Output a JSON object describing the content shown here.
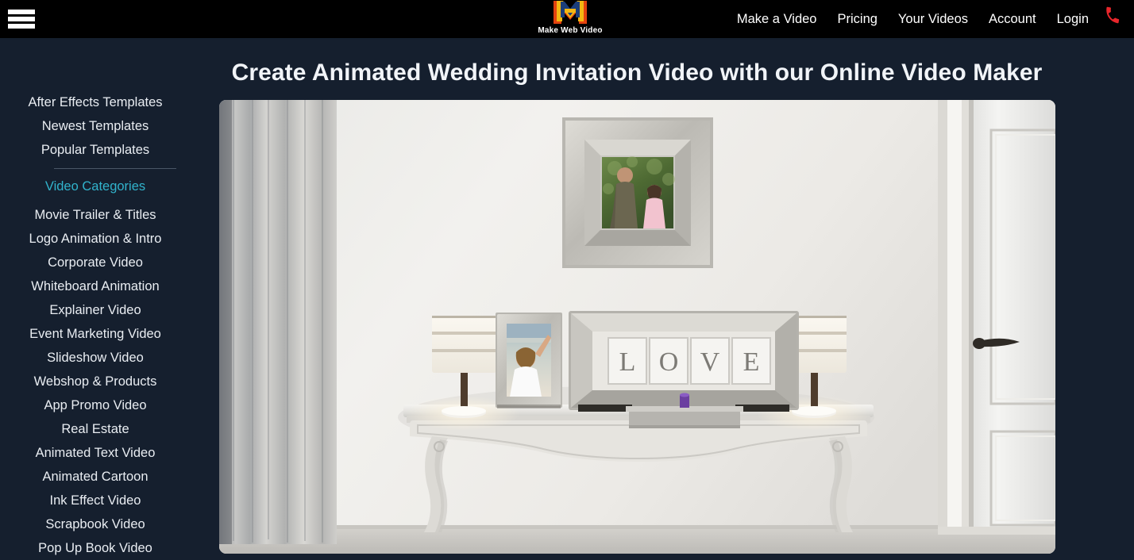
{
  "topbar": {
    "menu_icon": "hamburger-menu-icon",
    "logo": {
      "icon": "make-web-video-logo-icon",
      "text": "Make Web Video",
      "colors": {
        "outer": "#e4420f",
        "middle": "#f3b713",
        "inner": "#1b3e7a"
      }
    },
    "nav": [
      {
        "label": "Make a Video",
        "name": "nav-make-a-video"
      },
      {
        "label": "Pricing",
        "name": "nav-pricing"
      },
      {
        "label": "Your Videos",
        "name": "nav-your-videos"
      },
      {
        "label": "Account",
        "name": "nav-account"
      },
      {
        "label": "Login",
        "name": "nav-login"
      }
    ],
    "phone": {
      "icon": "phone-icon",
      "glyph": "☎",
      "color": "#e8262b"
    },
    "background": "#000000"
  },
  "page": {
    "title": "Create Animated Wedding Invitation Video with our Online Video Maker",
    "background": "#151f2e",
    "accent": "#31b3cc"
  },
  "sidebar": {
    "top_links": [
      {
        "label": "After Effects Templates",
        "name": "sidebar-item-after-effects-templates"
      },
      {
        "label": "Newest Templates",
        "name": "sidebar-item-newest-templates"
      },
      {
        "label": "Popular Templates",
        "name": "sidebar-item-popular-templates"
      }
    ],
    "section_heading": {
      "label": "Video Categories",
      "name": "sidebar-heading-video-categories"
    },
    "categories": [
      {
        "label": "Movie Trailer & Titles",
        "name": "sidebar-item-movie-trailer-titles"
      },
      {
        "label": "Logo Animation & Intro",
        "name": "sidebar-item-logo-animation-intro"
      },
      {
        "label": "Corporate Video",
        "name": "sidebar-item-corporate-video"
      },
      {
        "label": "Whiteboard Animation",
        "name": "sidebar-item-whiteboard-animation"
      },
      {
        "label": "Explainer Video",
        "name": "sidebar-item-explainer-video"
      },
      {
        "label": "Event Marketing Video",
        "name": "sidebar-item-event-marketing-video"
      },
      {
        "label": "Slideshow Video",
        "name": "sidebar-item-slideshow-video"
      },
      {
        "label": "Webshop & Products",
        "name": "sidebar-item-webshop-products"
      },
      {
        "label": "App Promo Video",
        "name": "sidebar-item-app-promo-video"
      },
      {
        "label": "Real Estate",
        "name": "sidebar-item-real-estate"
      },
      {
        "label": "Animated Text Video",
        "name": "sidebar-item-animated-text-video"
      },
      {
        "label": "Animated Cartoon",
        "name": "sidebar-item-animated-cartoon"
      },
      {
        "label": "Ink Effect Video",
        "name": "sidebar-item-ink-effect-video"
      },
      {
        "label": "Scrapbook Video",
        "name": "sidebar-item-scrapbook-video"
      },
      {
        "label": "Pop Up Book Video",
        "name": "sidebar-item-pop-up-book-video"
      }
    ]
  },
  "stage": {
    "name": "video-preview",
    "scene": "wedding invitation template preview: white room interior with curtain, framed couple photo on wall, ornate console table with LOVE letter frame, two photo frames and two table lamps, white panel door on right",
    "love_letters": [
      "L",
      "O",
      "V",
      "E"
    ]
  }
}
